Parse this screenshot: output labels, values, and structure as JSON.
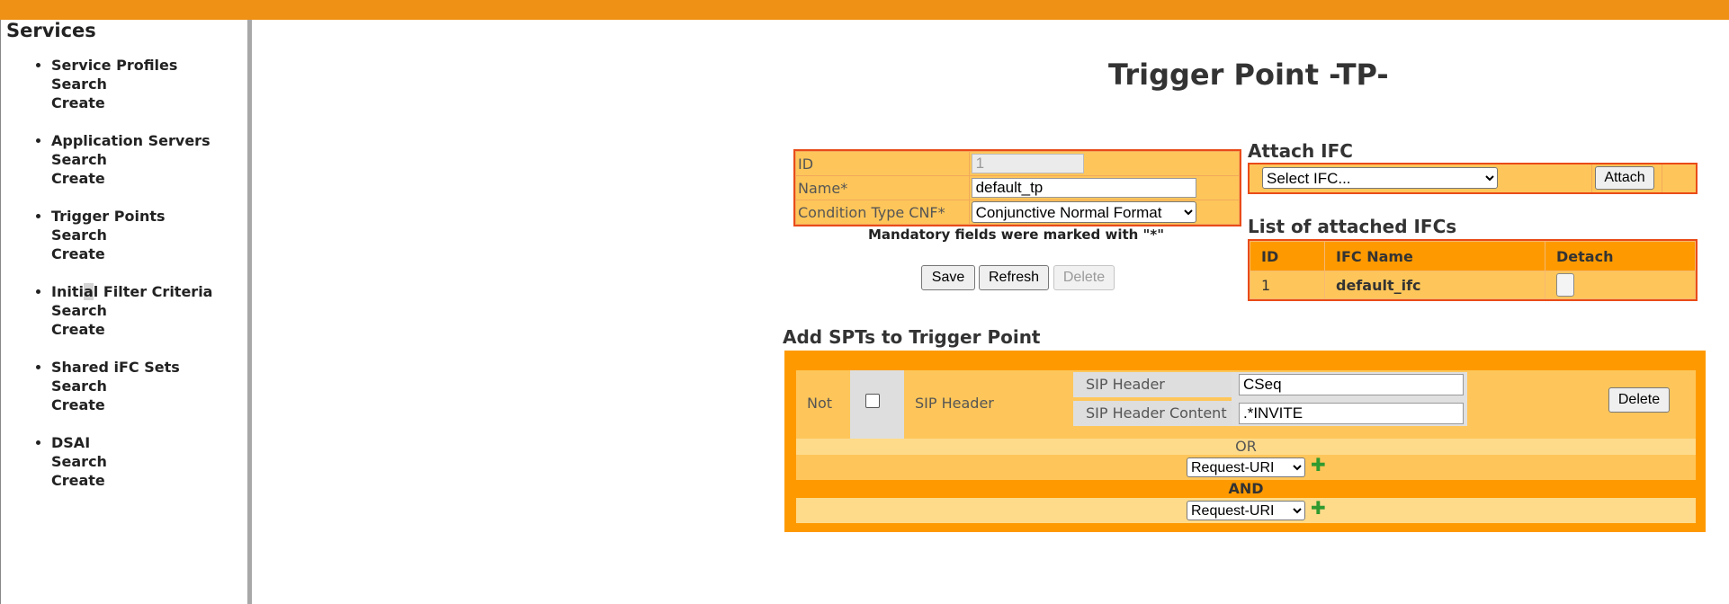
{
  "sidebar": {
    "title": "Services",
    "groups": [
      {
        "label": "Service Profiles",
        "search": "Search",
        "create": "Create"
      },
      {
        "label": "Application Servers",
        "search": "Search",
        "create": "Create"
      },
      {
        "label": "Trigger Points",
        "search": "Search",
        "create": "Create"
      },
      {
        "label_a": "Initi",
        "label_hl": "a",
        "label_b": "l Filter Criteria",
        "search": "Search",
        "create": "Create"
      },
      {
        "label": "Shared iFC Sets",
        "search": "Search",
        "create": "Create"
      },
      {
        "label": "DSAI",
        "search": "Search",
        "create": "Create"
      }
    ]
  },
  "page": {
    "title": "Trigger Point -TP-"
  },
  "form": {
    "id_label": "ID",
    "id_value": "1",
    "name_label": "Name*",
    "name_value": "default_tp",
    "cond_label": "Condition Type CNF*",
    "cond_value": "Conjunctive Normal Format",
    "mandatory_note": "Mandatory fields were marked with \"*\"",
    "save": "Save",
    "refresh": "Refresh",
    "delete": "Delete"
  },
  "attach": {
    "title": "Attach IFC",
    "select_value": "Select IFC...",
    "button": "Attach"
  },
  "ifc_list": {
    "title": "List of attached IFCs",
    "headers": [
      "ID",
      "IFC Name",
      "Detach"
    ],
    "rows": [
      {
        "id": "1",
        "name": "default_ifc"
      }
    ]
  },
  "spt": {
    "title": "Add SPTs to Trigger Point",
    "not_label": "Not",
    "type_label": "SIP Header",
    "header_label": "SIP Header",
    "header_value": "CSeq",
    "content_label": "SIP Header Content",
    "content_value": ".*INVITE",
    "delete": "Delete",
    "or_label": "OR",
    "and_label": "AND",
    "select_1": "Request-URI",
    "select_2": "Request-URI"
  },
  "colors": {
    "topbar": "#ee9114",
    "panel": "#fec65a",
    "panel_border": "#e94b18",
    "header": "#fe9a00",
    "band": "#fedb8b"
  }
}
